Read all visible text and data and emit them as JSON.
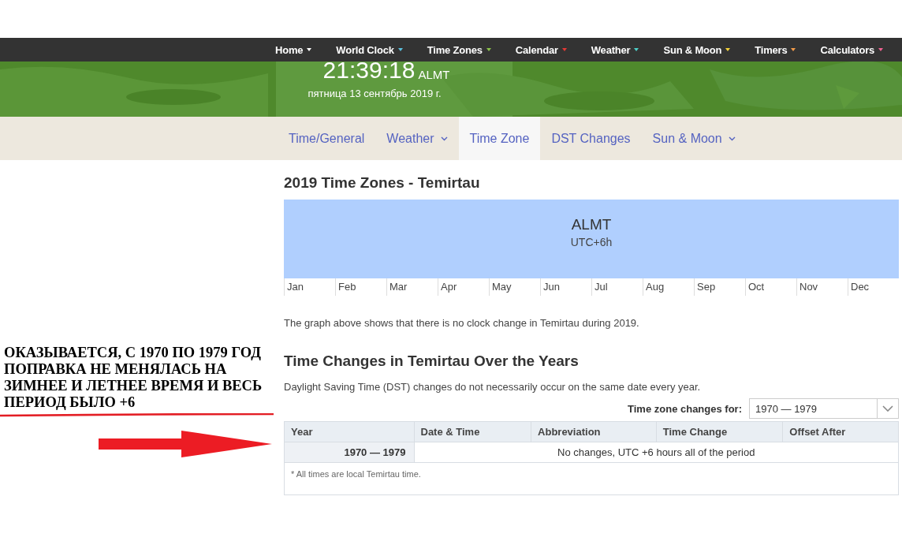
{
  "nav": [
    {
      "label": "Home",
      "color": "#ffffff"
    },
    {
      "label": "World Clock",
      "color": "#5bc0de"
    },
    {
      "label": "Time Zones",
      "color": "#8bc34a"
    },
    {
      "label": "Calendar",
      "color": "#e53935"
    },
    {
      "label": "Weather",
      "color": "#4dd0c8"
    },
    {
      "label": "Sun & Moon",
      "color": "#f5d33b"
    },
    {
      "label": "Timers",
      "color": "#f39c4a"
    },
    {
      "label": "Calculators",
      "color": "#f06292"
    }
  ],
  "clock": {
    "time": "21:39:18",
    "zone": "ALMT",
    "date": "пятница 13 сентябрь 2019 г."
  },
  "tabs": [
    {
      "label": "Time/General",
      "selected": false,
      "dropdown": false
    },
    {
      "label": "Weather",
      "selected": false,
      "dropdown": true
    },
    {
      "label": "Time Zone",
      "selected": true,
      "dropdown": false
    },
    {
      "label": "DST Changes",
      "selected": false,
      "dropdown": false
    },
    {
      "label": "Sun & Moon",
      "selected": false,
      "dropdown": true
    }
  ],
  "annotation": {
    "text": "ОКАЗЫВАЕТСЯ, С 1970 ПО 1979 ГОД ПОПРАВКА НЕ МЕНЯЛАСЬ НА ЗИМНЕЕ И ЛЕТНЕЕ ВРЕМЯ И ВЕСЬ ПЕРИОД БЫЛО +6"
  },
  "timeline": {
    "title": "2019 Time Zones - Temirtau",
    "zone": "ALMT",
    "offset": "UTC+6h",
    "months": [
      "Jan",
      "Feb",
      "Mar",
      "Apr",
      "May",
      "Jun",
      "Jul",
      "Aug",
      "Sep",
      "Oct",
      "Nov",
      "Dec"
    ],
    "note": "The graph above shows that there is no clock change in Temirtau during 2019."
  },
  "changes": {
    "title": "Time Changes in Temirtau Over the Years",
    "intro": "Daylight Saving Time (DST) changes do not necessarily occur on the same date every year.",
    "select_label": "Time zone changes for:",
    "select_value": "1970 — 1979",
    "columns": [
      "Year",
      "Date & Time",
      "Abbreviation",
      "Time Change",
      "Offset After"
    ],
    "rows": [
      {
        "year": "1970 — 1979",
        "summary": "No changes, UTC +6 hours all of the period"
      }
    ],
    "footnote": "* All times are local Temirtau time."
  }
}
